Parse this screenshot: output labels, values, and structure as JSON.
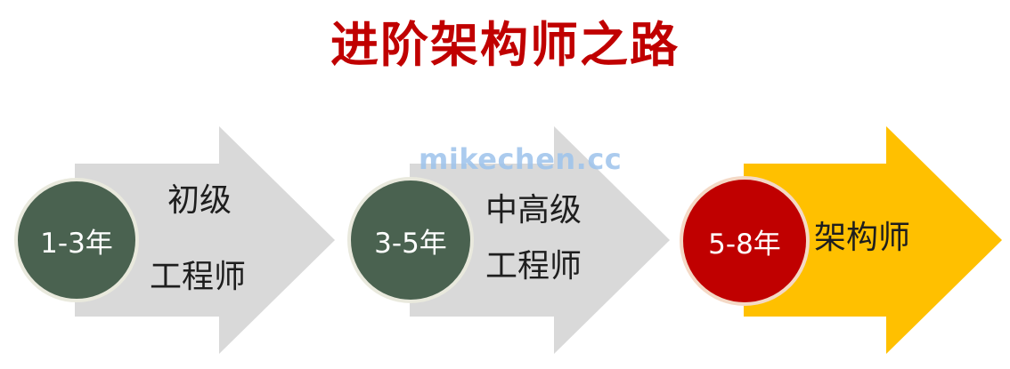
{
  "title": "进阶架构师之路",
  "watermark": "mikechen.cc",
  "stages": [
    {
      "years": "1-3年",
      "label_line1": "初级",
      "label_line2": "工程师"
    },
    {
      "years": "3-5年",
      "label_line1": "中高级",
      "label_line2": "工程师"
    },
    {
      "years": "5-8年",
      "label_line1": "架构师"
    }
  ],
  "colors": {
    "title": "#c00000",
    "arrow_gray": "#d9d9d9",
    "arrow_gold": "#ffc000",
    "circle_gray": "#4a6250",
    "circle_red": "#c00000",
    "watermark": "#9dc3ec"
  }
}
